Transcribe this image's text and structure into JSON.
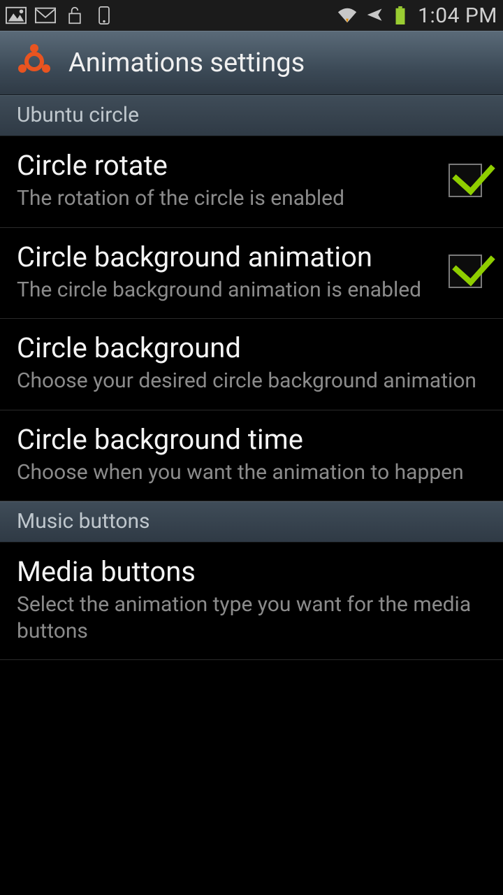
{
  "status": {
    "time": "1:04 PM"
  },
  "actionbar": {
    "title": "Animations settings"
  },
  "sections": {
    "ubuntu": {
      "label": "Ubuntu circle"
    },
    "music": {
      "label": "Music buttons"
    }
  },
  "prefs": {
    "rotate": {
      "title": "Circle rotate",
      "summary": "The rotation of the circle is enabled",
      "checked": true
    },
    "bgAnim": {
      "title": "Circle background animation",
      "summary": "The circle background animation is enabled",
      "checked": true
    },
    "bg": {
      "title": "Circle background",
      "summary": "Choose your desired circle background animation"
    },
    "bgTime": {
      "title": "Circle background time",
      "summary": "Choose when you want the animation to happen"
    },
    "media": {
      "title": "Media buttons",
      "summary": "Select the animation type you want for the media buttons"
    }
  }
}
